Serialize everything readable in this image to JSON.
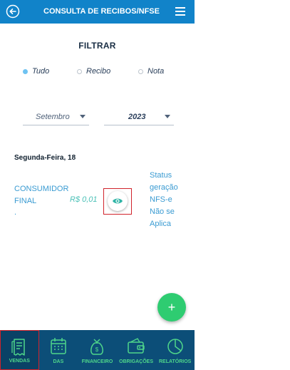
{
  "header": {
    "title": "CONSULTA DE RECIBOS/NFSE",
    "back_icon": "arrow-left-circle-icon",
    "menu_icon": "hamburger-menu-icon"
  },
  "filter": {
    "title": "FILTRAR",
    "options": [
      {
        "label": "Tudo",
        "selected": true
      },
      {
        "label": "Recibo",
        "selected": false
      },
      {
        "label": "Nota",
        "selected": false
      }
    ],
    "month": "Setembro",
    "year": "2023"
  },
  "records": {
    "day_label": "Segunda-Feira, 18",
    "items": [
      {
        "name_line1": "CONSUMIDOR",
        "name_line2": "FINAL",
        "extra": ".",
        "value": "R$ 0,01",
        "status_lines": [
          "Status",
          "geração",
          "NFS-e",
          "Não se",
          "Aplica"
        ]
      }
    ]
  },
  "fab": {
    "label": "+"
  },
  "bottom_nav": [
    {
      "label": "VENDAS",
      "icon": "receipt-icon",
      "active": true
    },
    {
      "label": "DAS",
      "icon": "calendar-icon",
      "active": false
    },
    {
      "label": "FINANCEIRO",
      "icon": "money-bag-icon",
      "active": false
    },
    {
      "label": "OBRIGAÇÕES",
      "icon": "wallet-icon",
      "active": false
    },
    {
      "label": "RELATÓRIOS",
      "icon": "pie-chart-icon",
      "active": false
    }
  ],
  "colors": {
    "header": "#1183c9",
    "nav": "#0c4e78",
    "accent_green": "#2ecc71",
    "link_blue": "#3a9bd2"
  }
}
